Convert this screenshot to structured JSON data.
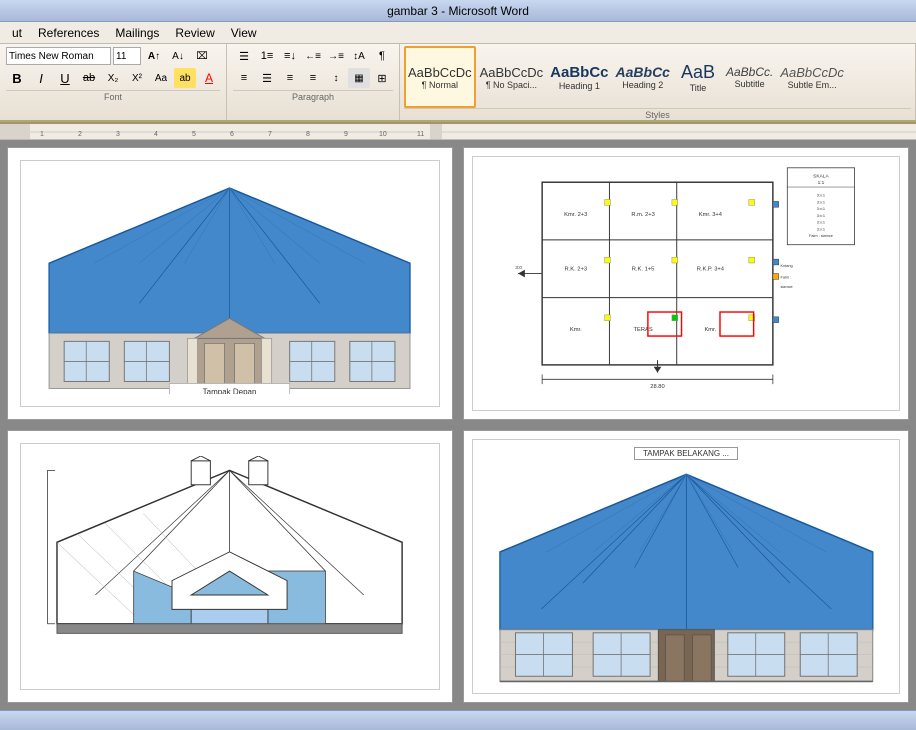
{
  "titleBar": {
    "text": "gambar 3 - Microsoft Word"
  },
  "menuBar": {
    "items": [
      "ut",
      "References",
      "Mailings",
      "Review",
      "View"
    ]
  },
  "ribbon": {
    "fontGroup": {
      "label": "Font",
      "fontName": "Times New Roman",
      "fontSize": "11",
      "boldLabel": "B",
      "italicLabel": "I",
      "underlineLabel": "U",
      "strikeLabel": "ab",
      "subLabel": "X₂",
      "supLabel": "X²",
      "caseLabel": "Aa",
      "colorLabel": "A"
    },
    "paragraphGroup": {
      "label": "Paragraph"
    },
    "stylesGroup": {
      "label": "Styles",
      "items": [
        {
          "name": "normal-style",
          "preview": "AaBbCcDc",
          "label": "¶ Normal",
          "active": true
        },
        {
          "name": "no-spacing-style",
          "preview": "AaBbCcDc",
          "label": "¶ No Spaci...",
          "active": false
        },
        {
          "name": "heading1-style",
          "preview": "AaBbCc",
          "label": "Heading 1",
          "active": false
        },
        {
          "name": "heading2-style",
          "preview": "AaBbCc",
          "label": "Heading 2",
          "active": false
        },
        {
          "name": "title-style",
          "preview": "AaB",
          "label": "Title",
          "active": false
        },
        {
          "name": "subtitle-style",
          "preview": "AaBbCc.",
          "label": "Subtitle",
          "active": false
        },
        {
          "name": "subtle-em-style",
          "preview": "AaBbCcDc",
          "label": "Subtle Em...",
          "active": false
        }
      ]
    }
  },
  "pages": [
    {
      "name": "front-elevation",
      "caption": "Tampak Depan",
      "quadrant": "top-left"
    },
    {
      "name": "floor-plan",
      "caption": "",
      "quadrant": "top-right"
    },
    {
      "name": "side-elevation",
      "caption": "",
      "quadrant": "bottom-left"
    },
    {
      "name": "rear-elevation",
      "caption": "TAMPAK BELAKANG ...",
      "quadrant": "bottom-right"
    }
  ],
  "statusBar": {
    "text": ""
  }
}
